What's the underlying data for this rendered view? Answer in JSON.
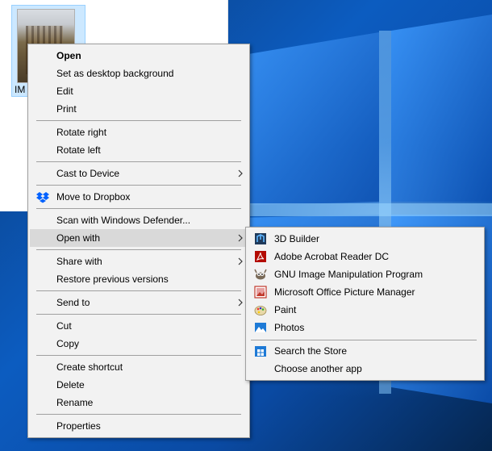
{
  "file": {
    "label": "IM"
  },
  "context_menu": {
    "items": [
      {
        "label": "Open"
      },
      {
        "label": "Set as desktop background"
      },
      {
        "label": "Edit"
      },
      {
        "label": "Print"
      },
      {
        "label": "Rotate right"
      },
      {
        "label": "Rotate left"
      },
      {
        "label": "Cast to Device"
      },
      {
        "label": "Move to Dropbox"
      },
      {
        "label": "Scan with Windows Defender..."
      },
      {
        "label": "Open with"
      },
      {
        "label": "Share with"
      },
      {
        "label": "Restore previous versions"
      },
      {
        "label": "Send to"
      },
      {
        "label": "Cut"
      },
      {
        "label": "Copy"
      },
      {
        "label": "Create shortcut"
      },
      {
        "label": "Delete"
      },
      {
        "label": "Rename"
      },
      {
        "label": "Properties"
      }
    ]
  },
  "open_with_menu": {
    "items": [
      {
        "label": "3D Builder",
        "icon": "3d-builder-icon"
      },
      {
        "label": "Adobe Acrobat Reader DC",
        "icon": "acrobat-icon"
      },
      {
        "label": "GNU Image Manipulation Program",
        "icon": "gimp-icon"
      },
      {
        "label": "Microsoft Office Picture Manager",
        "icon": "picture-manager-icon"
      },
      {
        "label": "Paint",
        "icon": "paint-icon"
      },
      {
        "label": "Photos",
        "icon": "photos-icon"
      },
      {
        "label": "Search the Store",
        "icon": "store-icon"
      },
      {
        "label": "Choose another app"
      }
    ]
  },
  "colors": {
    "menu_bg": "#f2f2f2",
    "highlight": "#d9d9d9",
    "desktop_blue": "#0c5cc0"
  }
}
